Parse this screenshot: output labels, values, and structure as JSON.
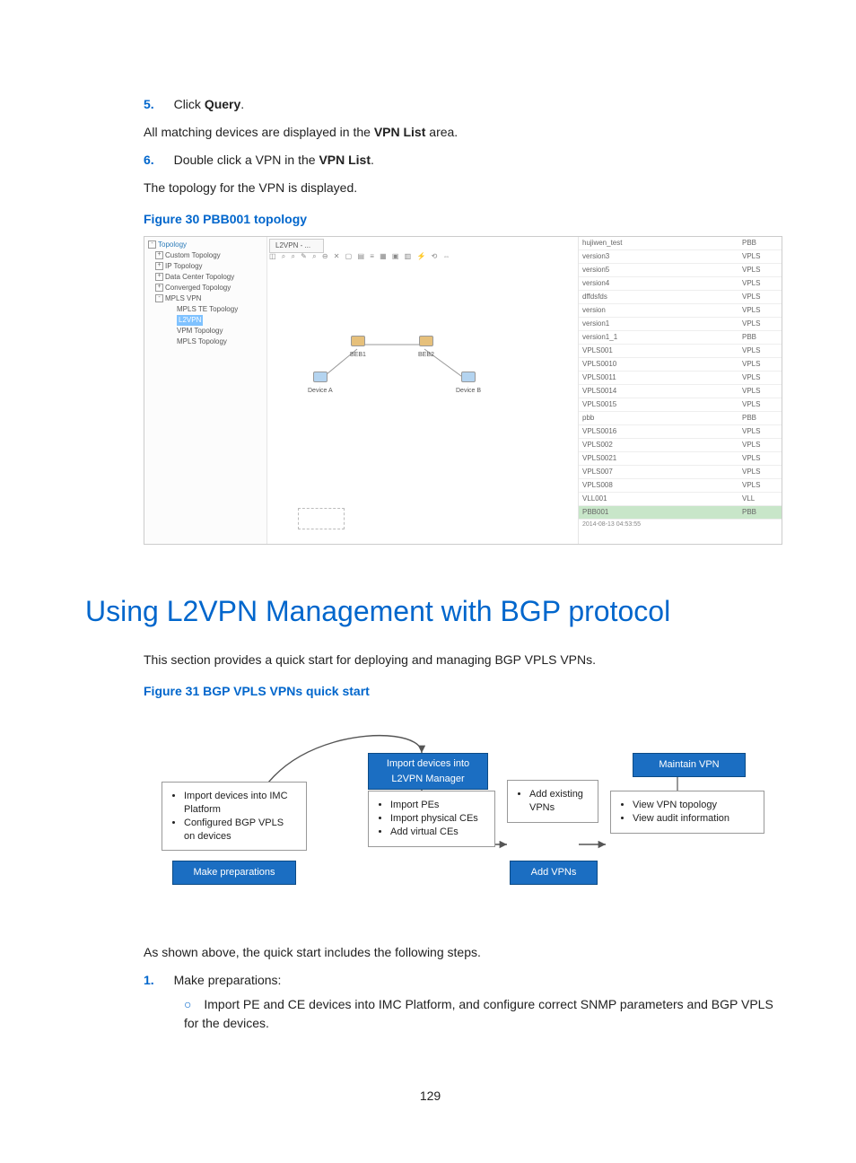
{
  "steps": {
    "s5_num": "5.",
    "s5_prefix": "Click ",
    "s5_bold": "Query",
    "s5_suffix": ".",
    "s5_result_a": "All matching devices are displayed in the ",
    "s5_result_bold": "VPN List",
    "s5_result_b": " area.",
    "s6_num": "6.",
    "s6_prefix": "Double click a VPN in the ",
    "s6_bold": "VPN List",
    "s6_suffix": ".",
    "s6_result": "The topology for the VPN is displayed."
  },
  "fig30": {
    "caption": "Figure 30 PBB001 topology",
    "tree": {
      "root": "Topology",
      "items": [
        {
          "label": "Custom Topology",
          "expand": "+"
        },
        {
          "label": "IP Topology",
          "expand": "+"
        },
        {
          "label": "Data Center Topology",
          "expand": "+"
        },
        {
          "label": "Converged Topology",
          "expand": "+"
        },
        {
          "label": "MPLS VPN",
          "expand": "-"
        },
        {
          "label": "MPLS TE Topology",
          "indent": true
        },
        {
          "label": "L2VPN",
          "indent": true,
          "selected": true
        },
        {
          "label": "VPM Topology",
          "indent": true
        },
        {
          "label": "MPLS Topology",
          "indent": true
        }
      ]
    },
    "tab": "L2VPN - ...",
    "toolbar_glyphs": "◫ ⌕ ⌕ ✎ ⌕ ⊖ ✕ ▢ ▤ ≡ ▦ ▣ ▥ ⚡ ⟲ ⇔",
    "nodes": {
      "beb1": "BEB1",
      "beb2": "BEB2",
      "devA": "Device A",
      "devB": "Device B"
    },
    "vpn_rows": [
      {
        "name": "hujiwen_test",
        "type": "PBB"
      },
      {
        "name": "version3",
        "type": "VPLS"
      },
      {
        "name": "version5",
        "type": "VPLS"
      },
      {
        "name": "version4",
        "type": "VPLS"
      },
      {
        "name": "dffdsfds",
        "type": "VPLS"
      },
      {
        "name": "version",
        "type": "VPLS"
      },
      {
        "name": "version1",
        "type": "VPLS"
      },
      {
        "name": "version1_1",
        "type": "PBB"
      },
      {
        "name": "VPLS001",
        "type": "VPLS"
      },
      {
        "name": "VPLS0010",
        "type": "VPLS"
      },
      {
        "name": "VPLS0011",
        "type": "VPLS"
      },
      {
        "name": "VPLS0014",
        "type": "VPLS"
      },
      {
        "name": "VPLS0015",
        "type": "VPLS"
      },
      {
        "name": "pbb",
        "type": "PBB"
      },
      {
        "name": "VPLS0016",
        "type": "VPLS"
      },
      {
        "name": "VPLS002",
        "type": "VPLS"
      },
      {
        "name": "VPLS0021",
        "type": "VPLS"
      },
      {
        "name": "VPLS007",
        "type": "VPLS"
      },
      {
        "name": "VPLS008",
        "type": "VPLS"
      },
      {
        "name": "VLL001",
        "type": "VLL"
      },
      {
        "name": "PBB001",
        "type": "PBB",
        "selected": true
      }
    ],
    "timestamp": "2014-08-13 04:53:55"
  },
  "section": {
    "title": "Using L2VPN Management with BGP protocol",
    "intro": "This section provides a quick start for deploying and managing BGP VPLS VPNs."
  },
  "fig31": {
    "caption": "Figure 31 BGP VPLS VPNs quick start",
    "prep_box": {
      "l1": "Import  devices into IMC Platform",
      "l2": "Configured  BGP VPLS on devices"
    },
    "btn_prep": "Make preparations",
    "import_btn": "Import devices into L2VPN Manager",
    "import_box": {
      "l1": "Import PEs",
      "l2": "Import physical CEs",
      "l3": "Add virtual CEs"
    },
    "addvpn_box": {
      "l1": "Add existing VPNs"
    },
    "btn_add": "Add VPNs",
    "maintain_btn": "Maintain VPN",
    "maintain_box": {
      "l1": "View VPN topology",
      "l2": "View audit information"
    }
  },
  "after": {
    "lead": "As shown above, the quick start includes the following steps.",
    "s1_num": "1.",
    "s1_text": "Make preparations:",
    "s1a_prefix": "Import PE and CE devices into IMC Platform, and configure correct SNMP parameters and BGP VPLS for the devices."
  },
  "page_number": "129"
}
